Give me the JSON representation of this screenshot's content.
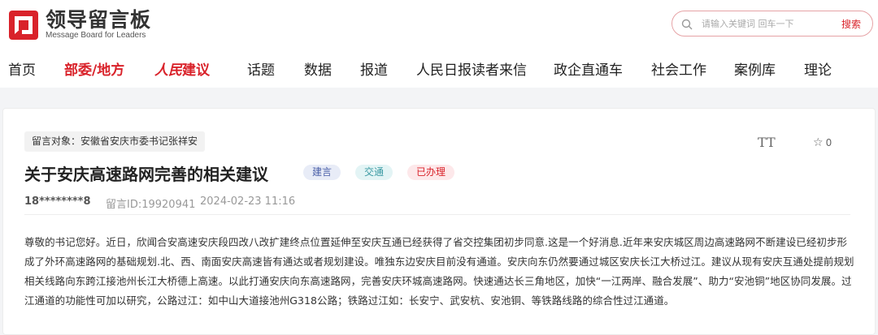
{
  "header": {
    "logo_cn": "领导留言板",
    "logo_en": "Message Board for Leaders",
    "search_placeholder": "请输入关键词 回车一下",
    "search_button": "搜索"
  },
  "nav": {
    "home": "首页",
    "ministries": "部委/地方",
    "brand_script": "人民",
    "brand_suffix": "建议",
    "topics": "话题",
    "data": "数据",
    "reports": "报道",
    "readers": "人民日报读者来信",
    "politics": "政企直通车",
    "social": "社会工作",
    "cases": "案例库",
    "theory": "理论"
  },
  "message": {
    "target": "留言对象：安徽省安庆市委书记张祥安",
    "font_icon": "TT",
    "favorites": "0",
    "title": "关于安庆高速路网完善的相关建议",
    "tags": [
      "建言",
      "交通",
      "已办理"
    ],
    "user": "18********8",
    "message_id": "留言ID:19920941",
    "datetime": "2024-02-23 11:16",
    "body": "尊敬的书记您好。近日，欣闻合安高速安庆段四改八改扩建终点位置延伸至安庆互通已经获得了省交控集团初步同意.这是一个好消息.近年来安庆城区周边高速路网不断建设已经初步形成了外环高速路网的基础规划.北、西、南面安庆高速皆有通达或者规划建设。唯独东边安庆目前没有通道。安庆向东仍然要通过城区安庆长江大桥过江。建议从现有安庆互通处提前规划相关线路向东跨江接池州长江大桥德上高速。以此打通安庆向东高速路网，完善安庆环城高速路网。快速通达长三角地区，加快“一江两岸、融合发展”、助力“安池铜”地区协同发展。过江通道的功能性可加以研究，公路过江：如中山大道接池州G318公路；铁路过江如：长安宁、武安杭、安池铜、等铁路线路的综合性过江通道。"
  },
  "colors": {
    "brand_red": "#d9222a",
    "tag_blue": "#4a5fa8",
    "tag_teal": "#3b9aa3"
  }
}
